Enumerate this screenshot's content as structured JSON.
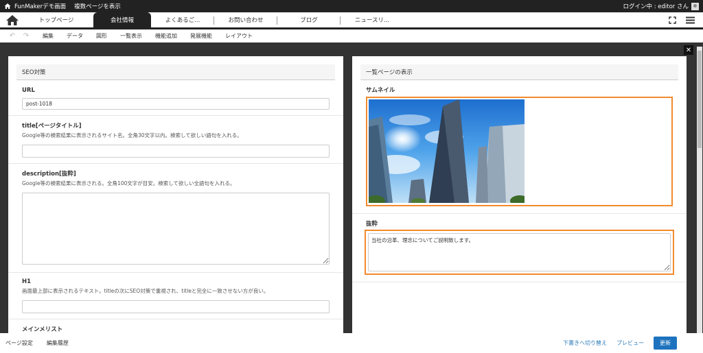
{
  "topbar": {
    "site_name": "FunMakerデモ画面",
    "page_action": "複数ページを表示",
    "login_status": "ログイン中 : editor さん"
  },
  "tabs": [
    {
      "label": "トップページ"
    },
    {
      "label": "会社情報"
    },
    {
      "label": "よくあるご..."
    },
    {
      "label": "お問い合わせ"
    },
    {
      "label": "ブログ"
    },
    {
      "label": "ニュースリ..."
    }
  ],
  "toolbar": {
    "items": [
      "編集",
      "データ",
      "図形",
      "一覧表示",
      "機能追加",
      "発展機能",
      "レイアウト"
    ]
  },
  "left_panel": {
    "title": "SEO対策",
    "url": {
      "label": "URL",
      "value": "post-1018"
    },
    "title_field": {
      "label": "title[ページタイトル]",
      "help": "Google等の検索結果に表示されるサイト名。全角30文字以内。検索して欲しい語句を入れる。",
      "value": ""
    },
    "description": {
      "label": "description[抜粋]",
      "help": "Google等の検索結果に表示される。全角100文字が目安。検索して欲しい全語句を入れる。",
      "value": ""
    },
    "h1": {
      "label": "H1",
      "help": "画面最上部に表示されるテキスト。titleの次にSEO対策で重視され、titleと完全に一致させない方が良い。",
      "value": ""
    },
    "next_label": "メインメリスト"
  },
  "right_panel": {
    "title": "一覧ページの表示",
    "thumbnail_label": "サムネイル",
    "excerpt_label": "抜粋",
    "excerpt_value": "当社の沿革、理念についてご説明致します。"
  },
  "bottombar": {
    "page_settings": "ページ設定",
    "edit_history": "編集履歴",
    "switch_draft": "下書きへ切り替え",
    "preview": "プレビュー",
    "update": "更新"
  },
  "colors": {
    "highlight": "#f28a2c",
    "primary": "#1e73be",
    "dark": "#222222"
  }
}
